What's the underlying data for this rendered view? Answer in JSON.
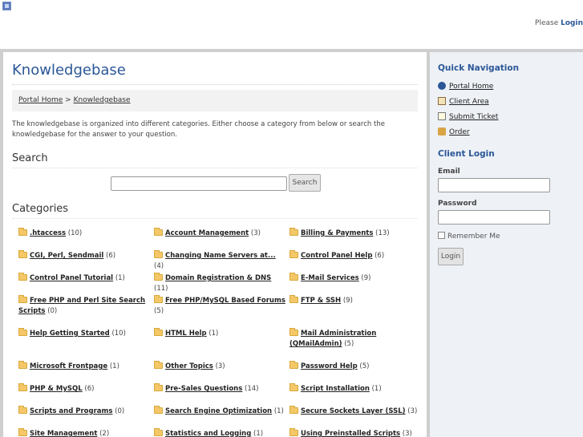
{
  "header": {
    "please_text": "Please",
    "login_link": "Login"
  },
  "main": {
    "title": "Knowledgebase",
    "breadcrumb": {
      "home": "Portal Home",
      "separator": ">",
      "current": "Knowledgebase"
    },
    "intro": "The knowledgebase is organized into different categories. Either choose a category from below or search the knowledgebase for the answer to your question.",
    "search_heading": "Search",
    "search_value": "",
    "search_button": "Search",
    "categories_heading": "Categories",
    "categories": [
      {
        "label": ".htaccess",
        "count": "(10)"
      },
      {
        "label": "Account Management",
        "count": "(3)"
      },
      {
        "label": "Billing & Payments",
        "count": "(13)"
      },
      {
        "label": "CGI, Perl, Sendmail",
        "count": "(6)"
      },
      {
        "label": "Changing Name Servers at...",
        "count": "(4)"
      },
      {
        "label": "Control Panel Help",
        "count": "(6)"
      },
      {
        "label": "Control Panel Tutorial",
        "count": "(1)"
      },
      {
        "label": "Domain Registration & DNS",
        "count": "(11)"
      },
      {
        "label": "E-Mail Services",
        "count": "(9)"
      },
      {
        "label": "Free PHP and Perl Site Search Scripts",
        "count": "(0)"
      },
      {
        "label": "Free PHP/MySQL Based Forums",
        "count": "(5)"
      },
      {
        "label": "FTP & SSH",
        "count": "(9)"
      },
      {
        "label": "Help Getting Started",
        "count": "(10)"
      },
      {
        "label": "HTML Help",
        "count": "(1)"
      },
      {
        "label": "Mail Administration (QMailAdmin)",
        "count": "(5)"
      },
      {
        "label": "Microsoft Frontpage",
        "count": "(1)"
      },
      {
        "label": "Other Topics",
        "count": "(3)"
      },
      {
        "label": "Password Help",
        "count": "(5)"
      },
      {
        "label": "PHP & MySQL",
        "count": "(6)"
      },
      {
        "label": "Pre-Sales Questions",
        "count": "(14)"
      },
      {
        "label": "Script Installation",
        "count": "(1)"
      },
      {
        "label": "Scripts and Programs",
        "count": "(0)"
      },
      {
        "label": "Search Engine Optimization",
        "count": "(1)"
      },
      {
        "label": "Secure Sockets Layer (SSL)",
        "count": "(3)"
      },
      {
        "label": "Site Management",
        "count": "(2)"
      },
      {
        "label": "Statistics and Logging",
        "count": "(1)"
      },
      {
        "label": "Using Preinstalled Scripts",
        "count": "(3)"
      }
    ]
  },
  "sidebar": {
    "nav_heading": "Quick Navigation",
    "nav": [
      {
        "label": "Portal Home",
        "icon": "globe-icon"
      },
      {
        "label": "Client Area",
        "icon": "house-icon"
      },
      {
        "label": "Submit Ticket",
        "icon": "ticket-icon"
      },
      {
        "label": "Order",
        "icon": "box-icon"
      }
    ],
    "login_heading": "Client Login",
    "email_label": "Email",
    "password_label": "Password",
    "remember_label": "Remember Me",
    "login_button": "Login"
  },
  "colors": {
    "accent": "#2b5797",
    "frame": "#cfcfcf",
    "sidebar_bg": "#eef1f6",
    "folder": "#f4c868"
  }
}
